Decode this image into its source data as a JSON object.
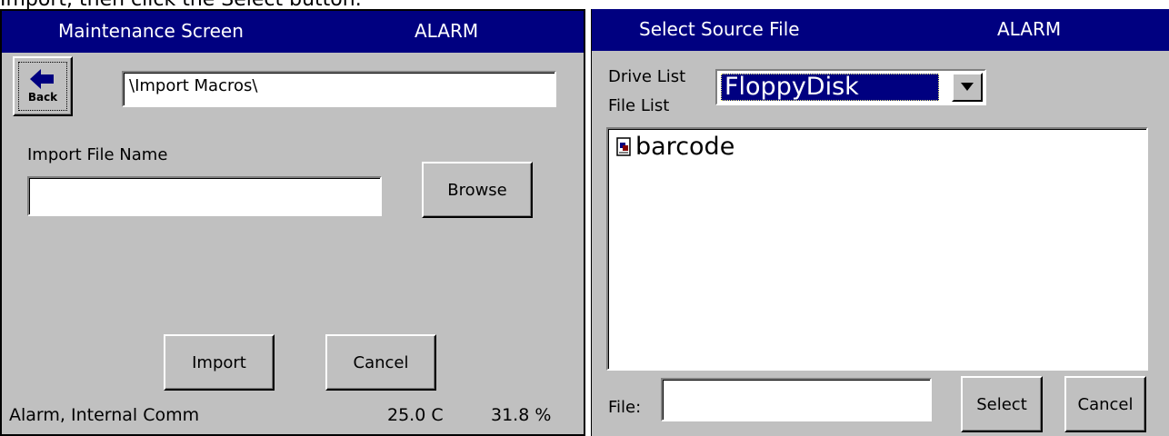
{
  "caption": "Import, then click the Select button.",
  "left": {
    "title": "Maintenance Screen",
    "alarm": "ALARM",
    "back_label": "Back",
    "path_value": "\\Import Macros\\",
    "import_file_label": "Import File Name",
    "import_file_value": "",
    "browse_label": "Browse",
    "import_label": "Import",
    "cancel_label": "Cancel",
    "status_text": "Alarm, Internal Comm",
    "temperature": "25.0 C",
    "humidity": "31.8 %"
  },
  "right": {
    "title": "Select Source File",
    "alarm": "ALARM",
    "drive_list_label": "Drive List",
    "file_list_label": "File List",
    "drive_selected": "FloppyDisk",
    "files": [
      {
        "name": "barcode",
        "icon": "document-icon"
      }
    ],
    "file_label": "File:",
    "file_value": "",
    "select_label": "Select",
    "cancel_label": "Cancel"
  },
  "colors": {
    "titlebar": "#000080",
    "panel": "#c0c0c0",
    "selection": "#000080"
  }
}
